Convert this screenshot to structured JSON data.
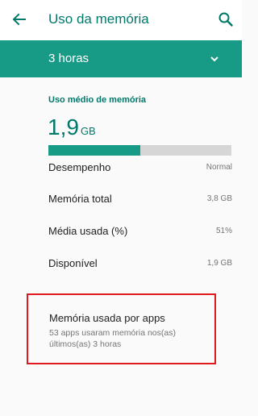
{
  "header": {
    "title": "Uso da memória",
    "back_icon": "arrow-left-icon",
    "search_icon": "search-icon"
  },
  "range": {
    "label": "3 horas",
    "icon": "chevron-down-icon"
  },
  "summary": {
    "section_title": "Uso médio de memória",
    "value": "1,9",
    "unit": "GB",
    "usage_fraction": 0.5
  },
  "stats": [
    {
      "label": "Desempenho",
      "value": "Normal"
    },
    {
      "label": "Memória total",
      "value": "3,8 GB"
    },
    {
      "label": "Média usada (%)",
      "value": "51%"
    },
    {
      "label": "Disponível",
      "value": "1,9 GB"
    }
  ],
  "apps": {
    "title": "Memória usada por apps",
    "subtitle": "53 apps usaram memória nos(as) últimos(as) 3 horas"
  },
  "colors": {
    "accent": "#00796b",
    "bar": "#179a86",
    "highlight_border": "#e0191f"
  }
}
